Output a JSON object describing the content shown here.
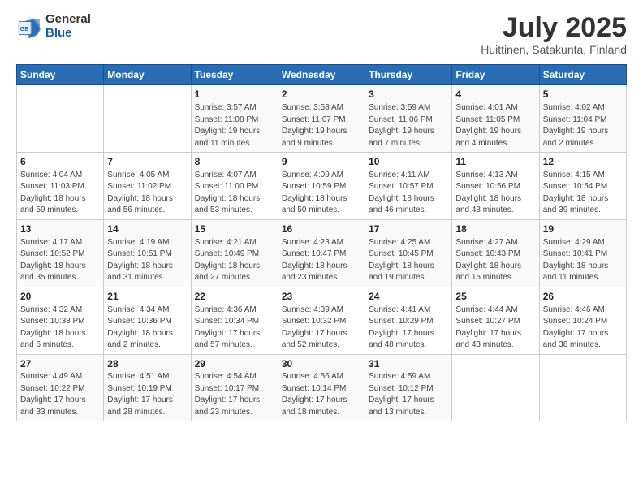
{
  "logo": {
    "general": "General",
    "blue": "Blue"
  },
  "title": "July 2025",
  "subtitle": "Huittinen, Satakunta, Finland",
  "headers": [
    "Sunday",
    "Monday",
    "Tuesday",
    "Wednesday",
    "Thursday",
    "Friday",
    "Saturday"
  ],
  "weeks": [
    [
      {
        "day": "",
        "info": ""
      },
      {
        "day": "",
        "info": ""
      },
      {
        "day": "1",
        "info": "Sunrise: 3:57 AM\nSunset: 11:08 PM\nDaylight: 19 hours\nand 11 minutes."
      },
      {
        "day": "2",
        "info": "Sunrise: 3:58 AM\nSunset: 11:07 PM\nDaylight: 19 hours\nand 9 minutes."
      },
      {
        "day": "3",
        "info": "Sunrise: 3:59 AM\nSunset: 11:06 PM\nDaylight: 19 hours\nand 7 minutes."
      },
      {
        "day": "4",
        "info": "Sunrise: 4:01 AM\nSunset: 11:05 PM\nDaylight: 19 hours\nand 4 minutes."
      },
      {
        "day": "5",
        "info": "Sunrise: 4:02 AM\nSunset: 11:04 PM\nDaylight: 19 hours\nand 2 minutes."
      }
    ],
    [
      {
        "day": "6",
        "info": "Sunrise: 4:04 AM\nSunset: 11:03 PM\nDaylight: 18 hours\nand 59 minutes."
      },
      {
        "day": "7",
        "info": "Sunrise: 4:05 AM\nSunset: 11:02 PM\nDaylight: 18 hours\nand 56 minutes."
      },
      {
        "day": "8",
        "info": "Sunrise: 4:07 AM\nSunset: 11:00 PM\nDaylight: 18 hours\nand 53 minutes."
      },
      {
        "day": "9",
        "info": "Sunrise: 4:09 AM\nSunset: 10:59 PM\nDaylight: 18 hours\nand 50 minutes."
      },
      {
        "day": "10",
        "info": "Sunrise: 4:11 AM\nSunset: 10:57 PM\nDaylight: 18 hours\nand 46 minutes."
      },
      {
        "day": "11",
        "info": "Sunrise: 4:13 AM\nSunset: 10:56 PM\nDaylight: 18 hours\nand 43 minutes."
      },
      {
        "day": "12",
        "info": "Sunrise: 4:15 AM\nSunset: 10:54 PM\nDaylight: 18 hours\nand 39 minutes."
      }
    ],
    [
      {
        "day": "13",
        "info": "Sunrise: 4:17 AM\nSunset: 10:52 PM\nDaylight: 18 hours\nand 35 minutes."
      },
      {
        "day": "14",
        "info": "Sunrise: 4:19 AM\nSunset: 10:51 PM\nDaylight: 18 hours\nand 31 minutes."
      },
      {
        "day": "15",
        "info": "Sunrise: 4:21 AM\nSunset: 10:49 PM\nDaylight: 18 hours\nand 27 minutes."
      },
      {
        "day": "16",
        "info": "Sunrise: 4:23 AM\nSunset: 10:47 PM\nDaylight: 18 hours\nand 23 minutes."
      },
      {
        "day": "17",
        "info": "Sunrise: 4:25 AM\nSunset: 10:45 PM\nDaylight: 18 hours\nand 19 minutes."
      },
      {
        "day": "18",
        "info": "Sunrise: 4:27 AM\nSunset: 10:43 PM\nDaylight: 18 hours\nand 15 minutes."
      },
      {
        "day": "19",
        "info": "Sunrise: 4:29 AM\nSunset: 10:41 PM\nDaylight: 18 hours\nand 11 minutes."
      }
    ],
    [
      {
        "day": "20",
        "info": "Sunrise: 4:32 AM\nSunset: 10:38 PM\nDaylight: 18 hours\nand 6 minutes."
      },
      {
        "day": "21",
        "info": "Sunrise: 4:34 AM\nSunset: 10:36 PM\nDaylight: 18 hours\nand 2 minutes."
      },
      {
        "day": "22",
        "info": "Sunrise: 4:36 AM\nSunset: 10:34 PM\nDaylight: 17 hours\nand 57 minutes."
      },
      {
        "day": "23",
        "info": "Sunrise: 4:39 AM\nSunset: 10:32 PM\nDaylight: 17 hours\nand 52 minutes."
      },
      {
        "day": "24",
        "info": "Sunrise: 4:41 AM\nSunset: 10:29 PM\nDaylight: 17 hours\nand 48 minutes."
      },
      {
        "day": "25",
        "info": "Sunrise: 4:44 AM\nSunset: 10:27 PM\nDaylight: 17 hours\nand 43 minutes."
      },
      {
        "day": "26",
        "info": "Sunrise: 4:46 AM\nSunset: 10:24 PM\nDaylight: 17 hours\nand 38 minutes."
      }
    ],
    [
      {
        "day": "27",
        "info": "Sunrise: 4:49 AM\nSunset: 10:22 PM\nDaylight: 17 hours\nand 33 minutes."
      },
      {
        "day": "28",
        "info": "Sunrise: 4:51 AM\nSunset: 10:19 PM\nDaylight: 17 hours\nand 28 minutes."
      },
      {
        "day": "29",
        "info": "Sunrise: 4:54 AM\nSunset: 10:17 PM\nDaylight: 17 hours\nand 23 minutes."
      },
      {
        "day": "30",
        "info": "Sunrise: 4:56 AM\nSunset: 10:14 PM\nDaylight: 17 hours\nand 18 minutes."
      },
      {
        "day": "31",
        "info": "Sunrise: 4:59 AM\nSunset: 10:12 PM\nDaylight: 17 hours\nand 13 minutes."
      },
      {
        "day": "",
        "info": ""
      },
      {
        "day": "",
        "info": ""
      }
    ]
  ]
}
